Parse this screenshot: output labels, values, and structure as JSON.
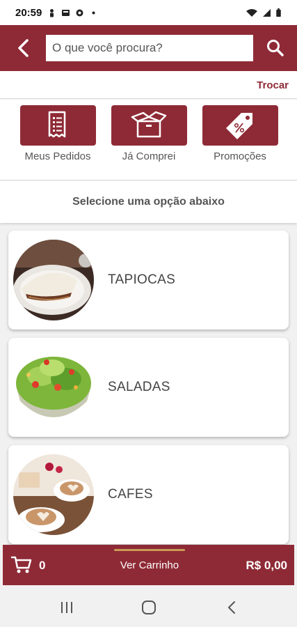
{
  "status_bar": {
    "time": "20:59"
  },
  "header": {
    "search_placeholder": "O que você procura?",
    "back_icon": "chevron-left-icon",
    "search_icon": "search-icon"
  },
  "location": {
    "change_label": "Trocar"
  },
  "quick_actions": [
    {
      "label": "Meus Pedidos",
      "icon": "receipt-icon"
    },
    {
      "label": "Já Comprei",
      "icon": "open-box-icon"
    },
    {
      "label": "Promoções",
      "icon": "discount-tag-icon"
    }
  ],
  "instructions": "Selecione uma opção abaixo",
  "categories": [
    {
      "name": "TAPIOCAS",
      "image": "tapioca-photo"
    },
    {
      "name": "SALADAS",
      "image": "salad-photo"
    },
    {
      "name": "CAFES",
      "image": "coffee-photo"
    }
  ],
  "cart": {
    "count": "0",
    "view_label": "Ver Carrinho",
    "total": "R$ 0,00",
    "icon": "shopping-cart-icon"
  },
  "colors": {
    "brand": "#8e2a36",
    "accent_line": "#c99b55",
    "background": "#f1f1f1"
  }
}
